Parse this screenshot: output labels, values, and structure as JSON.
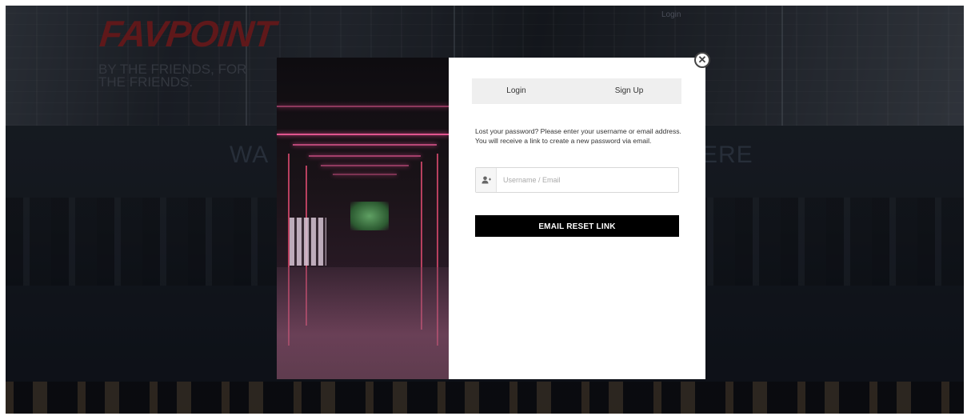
{
  "background_page": {
    "logo": "FAVPOINT",
    "tagline": "BY THE FRIENDS, FOR THE FRIENDS.",
    "top_nav_login": "Login",
    "hero_left": "WA",
    "hero_right": "ERE"
  },
  "modal": {
    "close_label": "✕",
    "tabs": [
      {
        "label": "Login"
      },
      {
        "label": "Sign Up"
      }
    ],
    "description": "Lost your password? Please enter your username or email address. You will receive a link to create a new password via email.",
    "username_field": {
      "value": "",
      "placeholder": "Username / Email",
      "icon": "user-add-icon"
    },
    "submit_label": "EMAIL RESET LINK"
  },
  "colors": {
    "brand_red": "#8e1f1f",
    "button_bg": "#000000",
    "tab_bg": "#efefef",
    "neon_pink": "#e0558f"
  }
}
